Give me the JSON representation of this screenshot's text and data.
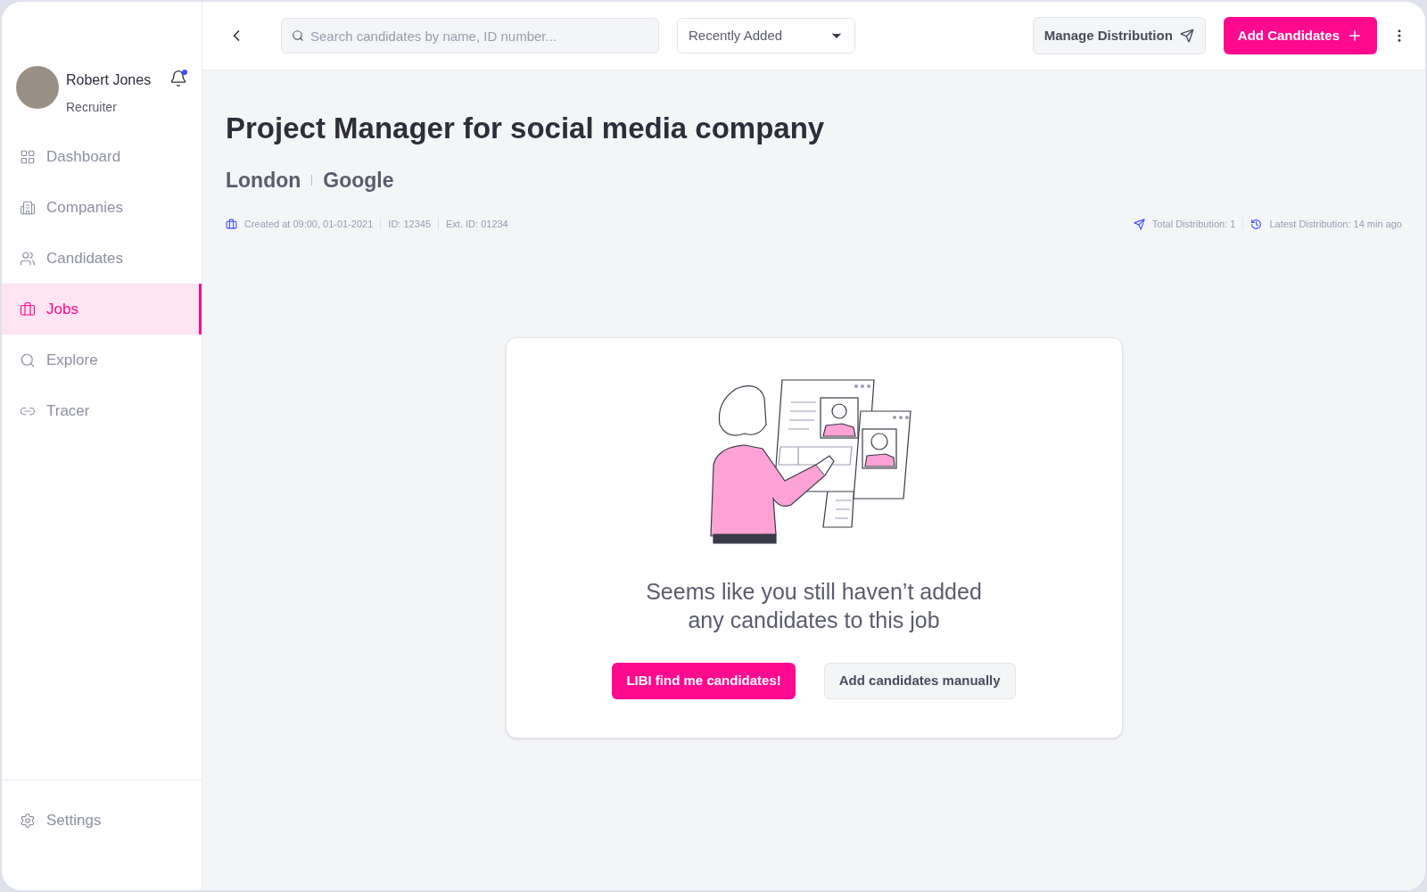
{
  "user": {
    "name": "Robert Jones",
    "role": "Recruiter",
    "has_notification": true
  },
  "sidebar": {
    "items": [
      {
        "label": "Dashboard",
        "selected": false
      },
      {
        "label": "Companies",
        "selected": false
      },
      {
        "label": "Candidates",
        "selected": false
      },
      {
        "label": "Jobs",
        "selected": true
      },
      {
        "label": "Explore",
        "selected": false
      },
      {
        "label": "Tracer",
        "selected": false
      }
    ],
    "settings": {
      "label": "Settings",
      "selected": false
    }
  },
  "toolbar": {
    "search": {
      "placeholder": "Search candidates by name, ID number..."
    },
    "sort": {
      "value": "Recently Added"
    },
    "manage_button": "Manage Distribution",
    "add_button": "Add Candidates"
  },
  "job": {
    "title": "Project Manager for social media company",
    "location": "London",
    "company": "Google",
    "meta": [
      "Created at 09:00, 01-01-2021",
      "ID: 12345",
      "Ext. ID: 01234"
    ],
    "total_distribution": "Total Distribution: 1",
    "latest_distribution": "Latest Distribution: 14 min ago"
  },
  "empty_state": {
    "message_lines": [
      "Seems like you still haven’t added",
      "any candidates to this job"
    ],
    "primary_button": "LIBI find me candidates!",
    "secondary_button": "Add candidates manually"
  }
}
